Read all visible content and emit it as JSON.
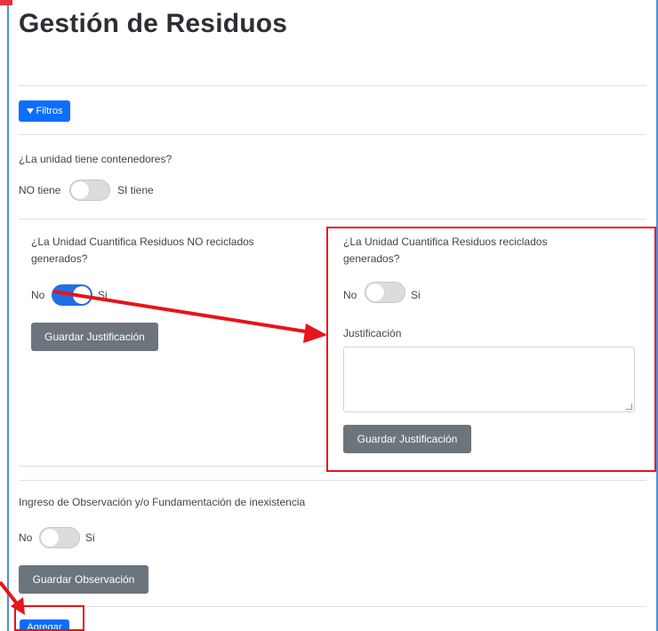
{
  "page": {
    "title": "Gestión de Residuos"
  },
  "filter_button": {
    "label": "Filtros",
    "icon": "filter-icon"
  },
  "containers": {
    "question": "¿La unidad tiene contenedores?",
    "off_label": "NO tiene",
    "on_label": "SI tiene",
    "enabled": false
  },
  "non_recycled": {
    "question_line1": "¿La Unidad Cuantifica Residuos NO reciclados",
    "question_line2": "generados?",
    "off_label": "No",
    "on_label": "Si",
    "enabled": true,
    "save_label": "Guardar Justificación"
  },
  "recycled": {
    "question_line1": "¿La Unidad Cuantifica Residuos reciclados",
    "question_line2": "generados?",
    "off_label": "No",
    "on_label": "Si",
    "enabled": false,
    "justification_label": "Justificación",
    "justification_value": "",
    "save_label": "Guardar Justificación"
  },
  "observation": {
    "question": "Ingreso de Observación y/o Fundamentación de inexistencia",
    "off_label": "No",
    "on_label": "Si",
    "enabled": false,
    "save_label": "Guardar Observación"
  },
  "add_button": {
    "label": "Agregar"
  },
  "colors": {
    "primary": "#0d6efd",
    "secondary": "#6c757d",
    "highlight": "#e8131b"
  }
}
